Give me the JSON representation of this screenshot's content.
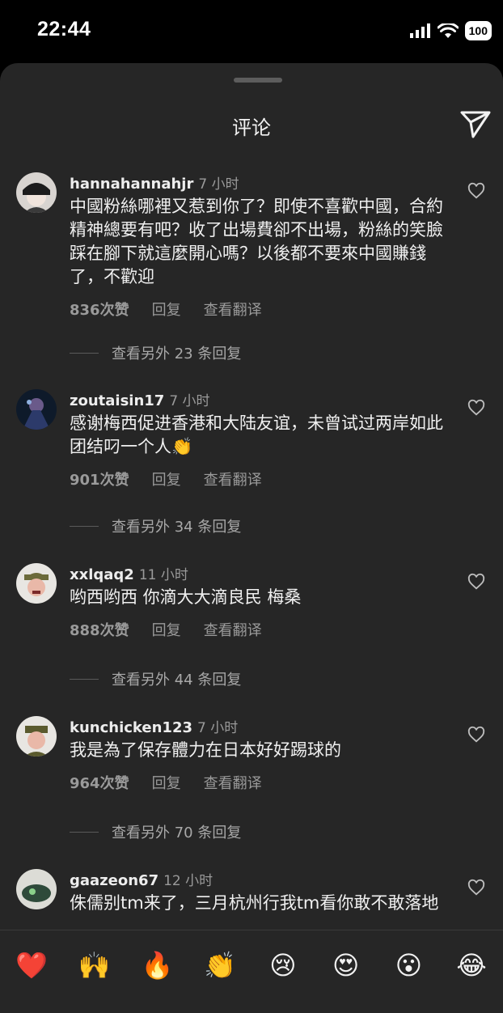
{
  "status_bar": {
    "time": "22:44",
    "battery": "100"
  },
  "header": {
    "title": "评论"
  },
  "comments": [
    {
      "username": "hannahannahjr",
      "time": "7 小时",
      "text": "中國粉絲哪裡又惹到你了？即使不喜歡中國，合約精神總要有吧？收了出場費卻不出場，粉絲的笑臉踩在腳下就這麼開心嗎？以後都不要來中國賺錢了，不歡迎",
      "likes": "836",
      "likes_suffix": "次赞",
      "reply": "回复",
      "translate": "查看翻译",
      "view_replies": "查看另外 23 条回复"
    },
    {
      "username": "zoutaisin17",
      "time": "7 小时",
      "text": "感谢梅西促进香港和大陆友谊，未曾试过两岸如此团结叼一个人👏",
      "likes": "901",
      "likes_suffix": "次赞",
      "reply": "回复",
      "translate": "查看翻译",
      "view_replies": "查看另外 34 条回复"
    },
    {
      "username": "xxlqaq2",
      "time": "11 小时",
      "text": "哟西哟西 你滴大大滴良民 梅桑",
      "likes": "888",
      "likes_suffix": "次赞",
      "reply": "回复",
      "translate": "查看翻译",
      "view_replies": "查看另外 44 条回复"
    },
    {
      "username": "kunchicken123",
      "time": "7 小时",
      "text": "我是為了保存體力在日本好好踢球的",
      "likes": "964",
      "likes_suffix": "次赞",
      "reply": "回复",
      "translate": "查看翻译",
      "view_replies": "查看另外 70 条回复"
    },
    {
      "username": "gaazeon67",
      "time": "12 小时",
      "text": "侏儒别tm来了，三月杭州行我tm看你敢不敢落地"
    }
  ],
  "emoji_reactions": [
    "❤️",
    "🙌",
    "🔥",
    "👏",
    "😢",
    "😍",
    "😮",
    "😂"
  ],
  "colors": {
    "background": "#262626",
    "status_bar": "#000000",
    "text": "#f2f2f2",
    "muted": "#9a9a9a"
  }
}
